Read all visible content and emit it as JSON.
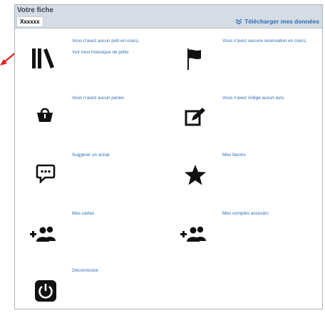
{
  "header": {
    "title": "Votre fiche",
    "user_name": "Xxxxxx",
    "download_label": "Télécharger mes données"
  },
  "tiles": {
    "loans": {
      "status": "Vous n'avez aucun prêt en cours.",
      "link": "Voir mon historique de prêts",
      "icon": "books-icon"
    },
    "reservations": {
      "status": "Vous n'avez aucune réservation en cours.",
      "icon": "flag-icon"
    },
    "basket": {
      "status": "Vous n'avez aucun panier.",
      "icon": "shopping-basket-icon"
    },
    "reviews": {
      "status": "Vous n'avez rédigé aucun avis.",
      "icon": "edit-icon"
    },
    "suggest": {
      "label": "Suggérer un achat",
      "icon": "chat-bubble-icon"
    },
    "favorites": {
      "label": "Mes favoris",
      "icon": "star-icon"
    },
    "cards": {
      "label": "Mes cartes",
      "icon": "add-users-icon"
    },
    "accounts": {
      "label": "Mes comptes associés",
      "icon": "add-users-icon"
    },
    "logout": {
      "label": "Déconnexion",
      "icon": "power-icon"
    }
  },
  "colors": {
    "link": "#2f6db5",
    "header_bg": "#d5dce3",
    "annotation_arrow": "#e0201b"
  }
}
